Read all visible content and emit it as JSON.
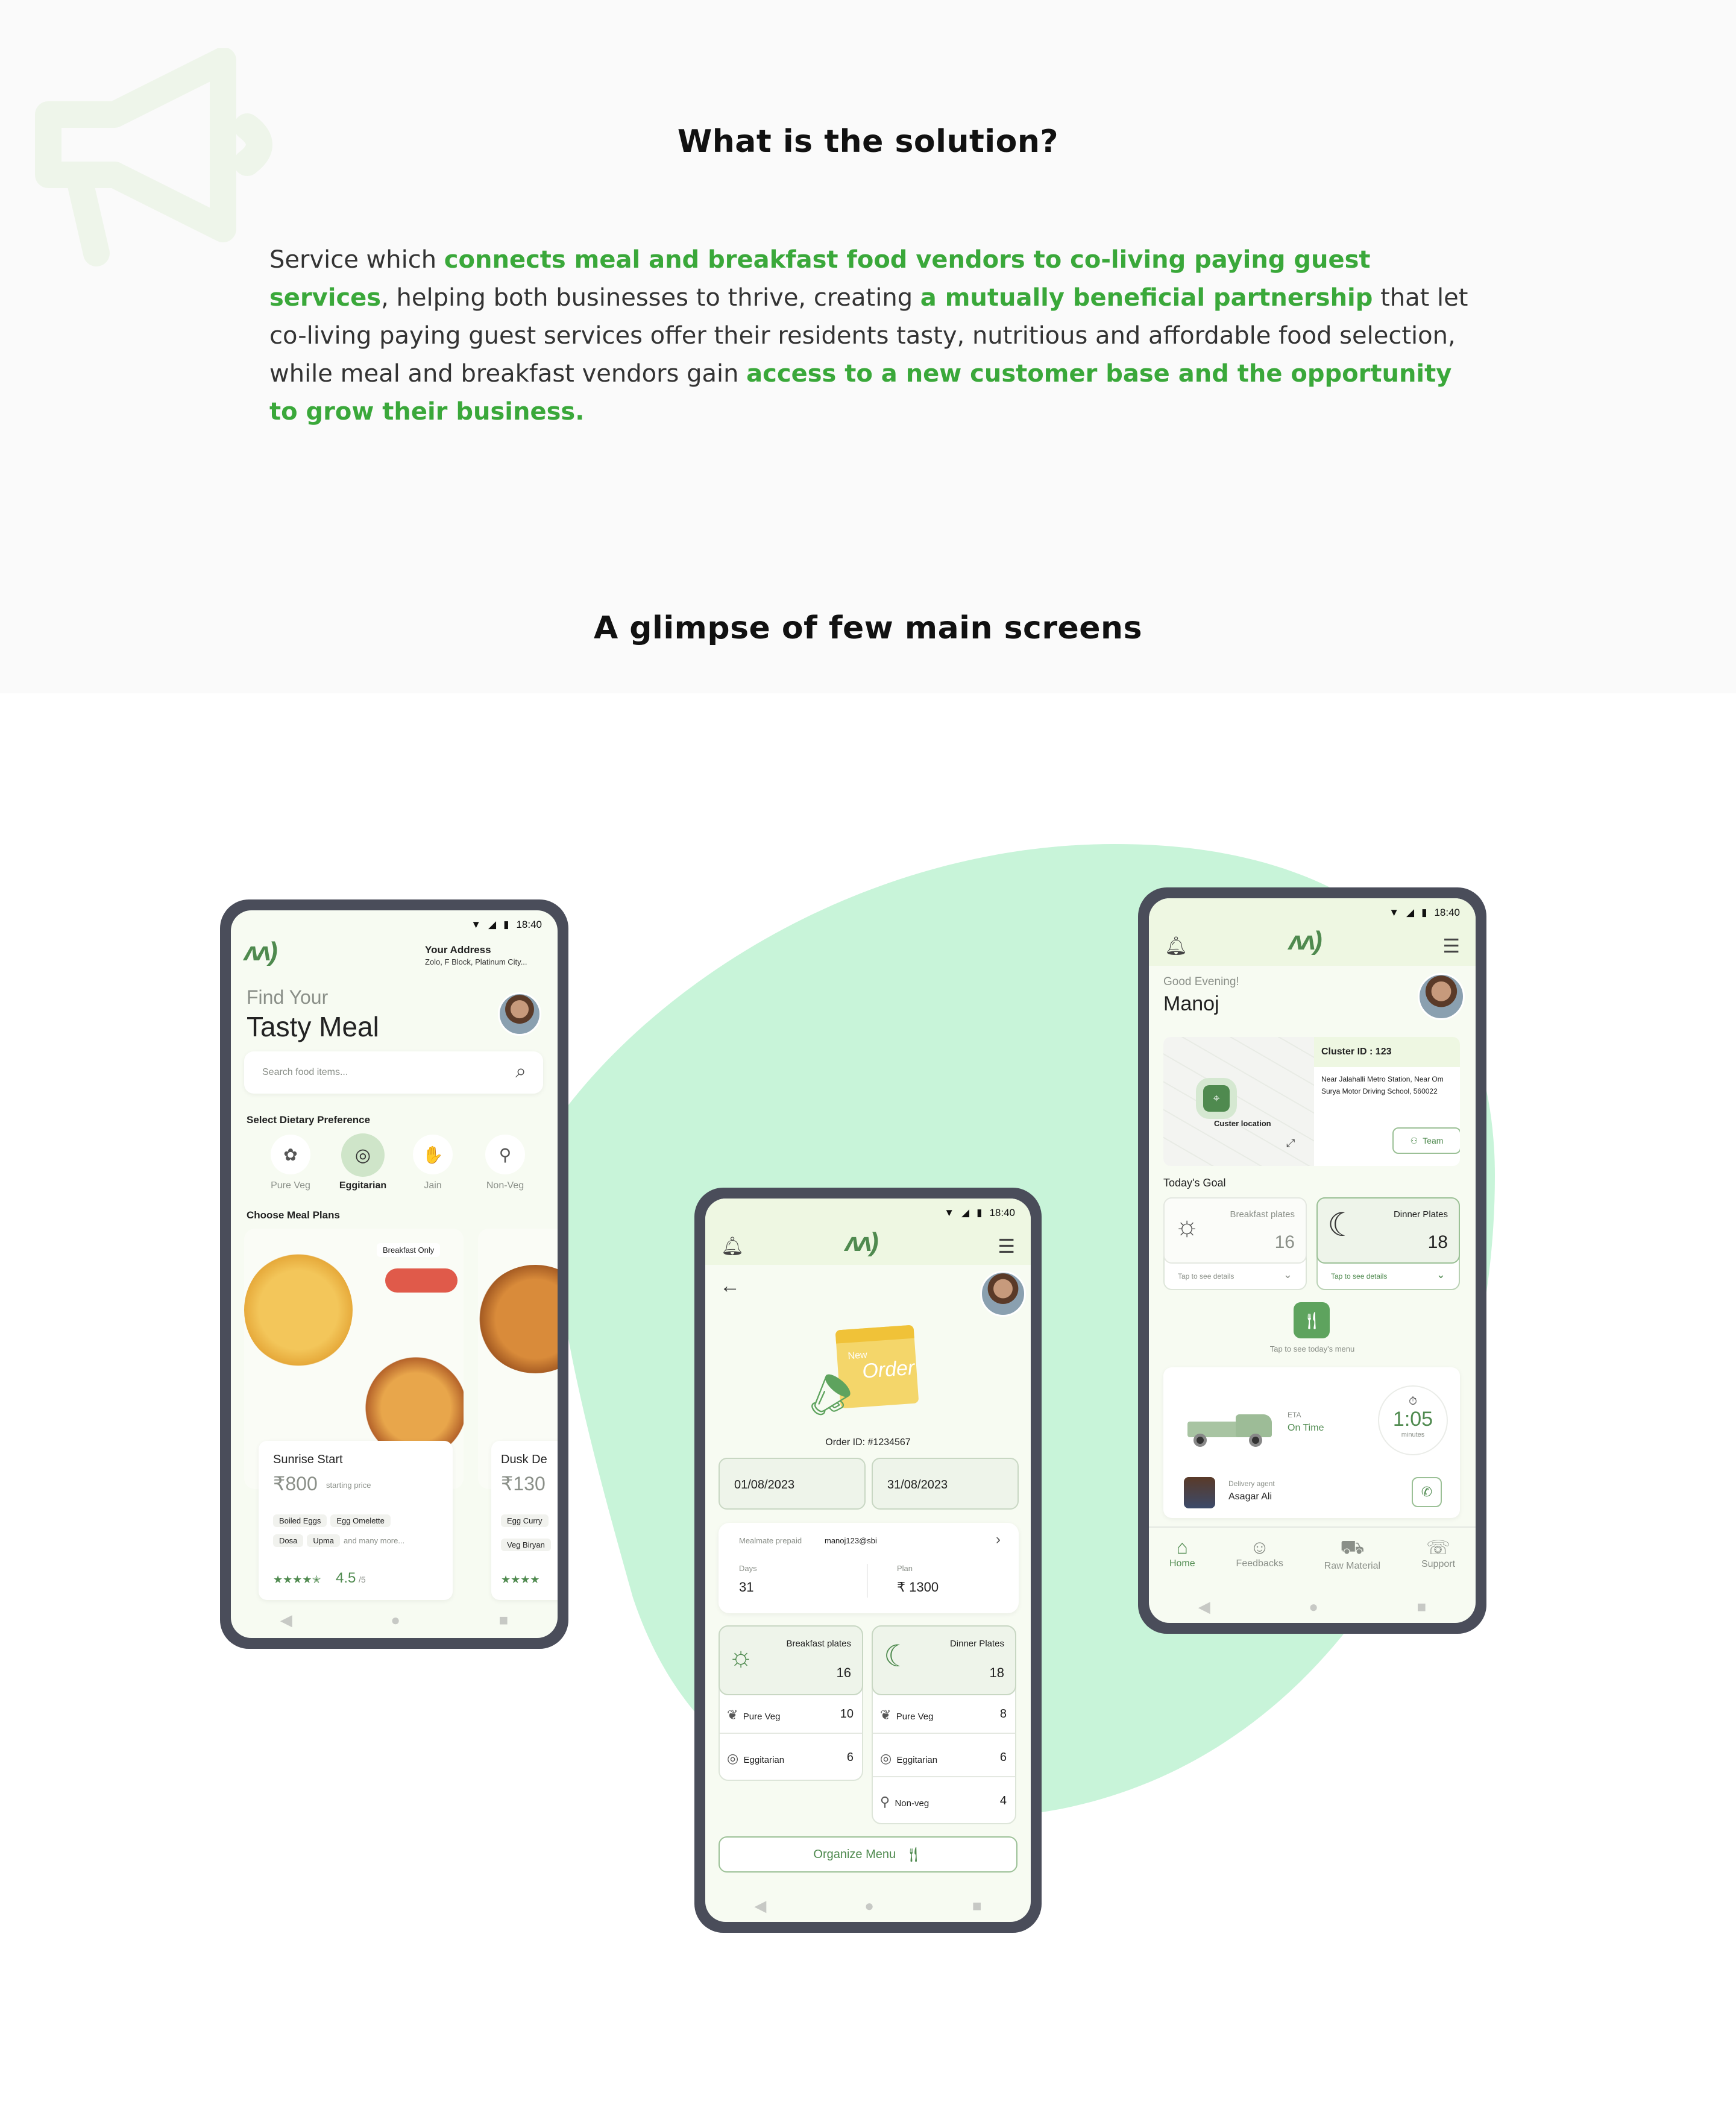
{
  "solution": {
    "title": "What is the solution?",
    "p1": "Service which ",
    "h1": "connects meal and breakfast food vendors to co-living paying guest services",
    "p2": ", helping both businesses to thrive, creating ",
    "h2": "a mutually beneficial partnership",
    "p3": " that let co-living paying guest services offer their residents tasty, nutritious and affordable food selection, while meal and breakfast vendors gain ",
    "h3": "access to a new customer base and the opportunity to grow their business."
  },
  "glimpse_title": "A glimpse of few  main screens",
  "colors": {
    "accent": "#3aa83a",
    "blob": "#c8f4d9",
    "phone_frame": "#4a4d5a",
    "screen_bg": "#f7fbf2"
  },
  "status_time": "18:40",
  "phone1": {
    "address_label": "Your Address",
    "address": "Zolo, F Block, Platinum City...",
    "find_your": "Find Your",
    "tasty_meal": "Tasty Meal",
    "search_placeholder": "Search food items...",
    "dietary_label": "Select Dietary Preference",
    "prefs": [
      "Pure Veg",
      "Eggitarian",
      "Jain",
      "Non-Veg"
    ],
    "plans_label": "Choose Meal Plans",
    "badge": "Breakfast Only",
    "plan1": {
      "name": "Sunrise Start",
      "price": "₹800",
      "price_note": "starting price",
      "items": [
        "Boiled Eggs",
        "Egg Omelette",
        "Dosa",
        "Upma"
      ],
      "more": "and many more...",
      "rating": "4.5",
      "rating_max": "/5"
    },
    "plan2": {
      "name": "Dusk De",
      "price": "₹130",
      "items": [
        "Egg Curry",
        "Veg Biryan"
      ]
    }
  },
  "phone2": {
    "note_new": "New",
    "note_order": "Order",
    "order_id": "Order ID: #1234567",
    "date_from": "01/08/2023",
    "date_to": "31/08/2023",
    "prepaid_label": "Mealmate prepaid",
    "upi": "manoj123@sbi",
    "days_label": "Days",
    "days": "31",
    "plan_label": "Plan",
    "plan": "₹ 1300",
    "breakfast_label": "Breakfast plates",
    "breakfast": "16",
    "dinner_label": "Dinner Plates",
    "dinner": "18",
    "b_rows": [
      {
        "name": "Pure Veg",
        "val": "10"
      },
      {
        "name": "Eggitarian",
        "val": "6"
      }
    ],
    "d_rows": [
      {
        "name": "Pure Veg",
        "val": "8"
      },
      {
        "name": "Eggitarian",
        "val": "6"
      },
      {
        "name": "Non-veg",
        "val": "4"
      }
    ],
    "organize": "Organize Menu"
  },
  "phone3": {
    "greeting": "Good Evening!",
    "name": "Manoj",
    "cluster": "Cluster ID : 123",
    "address": "Near Jalahalli Metro Station, Near Om Surya Motor Driving School, 560022",
    "map_label": "Custer location",
    "team": "Team",
    "goal": "Today's Goal",
    "breakfast_label": "Breakfast plates",
    "breakfast": "16",
    "dinner_label": "Dinner Plates",
    "dinner": "18",
    "tap_details": "Tap to see details",
    "tap_menu": "Tap to see today's menu",
    "eta_label": "ETA",
    "eta_status": "On Time",
    "eta_time": "1:05",
    "eta_unit": "minutes",
    "agent_label": "Delivery agent",
    "agent": "Asagar Ali",
    "nav": [
      "Home",
      "Feedbacks",
      "Raw Material",
      "Support"
    ]
  }
}
